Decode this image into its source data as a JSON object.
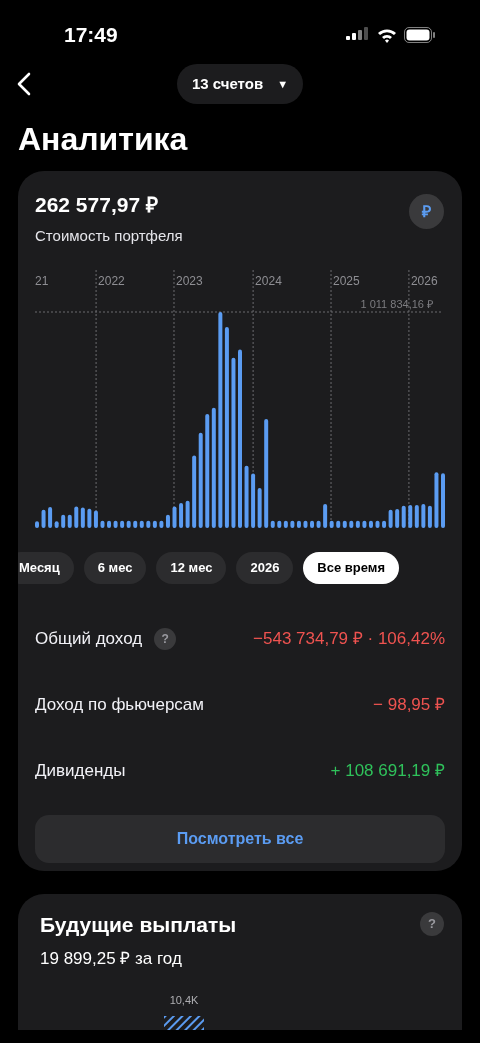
{
  "status_bar": {
    "time": "17:49"
  },
  "header": {
    "accounts": "13 счетов",
    "caret": "▼",
    "title": "Аналитика"
  },
  "portfolio": {
    "value": "262 577,97 ₽",
    "label": "Стоимость портфеля",
    "currency": "₽",
    "chart": {
      "year_labels": [
        "21",
        "2022",
        "2023",
        "2024",
        "2025",
        "2026"
      ],
      "max_label": "1 011 834,16 ₽"
    },
    "periods": [
      {
        "label": "Месяц",
        "selected": false
      },
      {
        "label": "6 мес",
        "selected": false
      },
      {
        "label": "12 мес",
        "selected": false
      },
      {
        "label": "2026",
        "selected": false
      },
      {
        "label": "Все время",
        "selected": true
      }
    ],
    "rows": [
      {
        "label": "Общий доход",
        "help": "?",
        "value": "−543 734,79 ₽ · 106,42%",
        "color": "#ef5350"
      },
      {
        "label": "Доход по фьючерсам",
        "value": "− 98,95 ₽",
        "color": "#ef5350"
      },
      {
        "label": "Дивиденды",
        "value": "+ 108 691,19 ₽",
        "color": "#2fc25b"
      }
    ],
    "button": "Посмотреть все"
  },
  "payouts": {
    "title": "Будущие выплаты",
    "help": "?",
    "summary": "19 899,25 ₽ за год",
    "bar_label": "10,4K"
  }
}
